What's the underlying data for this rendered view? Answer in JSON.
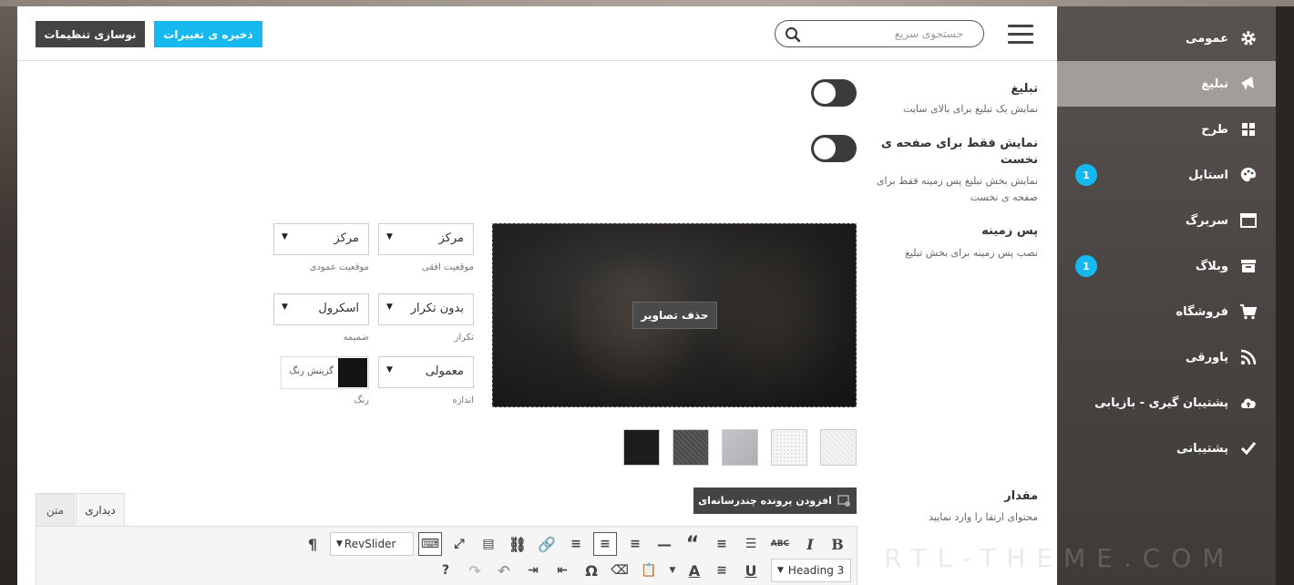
{
  "header": {
    "reset_label": "نوسازی تنظیمات",
    "save_label": "ذخیره ی تغییرات",
    "search_placeholder": "جستجوی سریع"
  },
  "sidebar": {
    "items": [
      {
        "label": "عمومی",
        "icon": "gear-icon"
      },
      {
        "label": "تبلیغ",
        "icon": "megaphone-icon",
        "active": true
      },
      {
        "label": "طرح",
        "icon": "grid-icon"
      },
      {
        "label": "استایل",
        "icon": "palette-icon",
        "badge": "1"
      },
      {
        "label": "سربرگ",
        "icon": "window-icon"
      },
      {
        "label": "وبلاگ",
        "icon": "archive-icon",
        "badge": "1"
      },
      {
        "label": "فروشگاه",
        "icon": "cart-icon"
      },
      {
        "label": "پاورقی",
        "icon": "rss-icon"
      },
      {
        "label": "پشتیبان گیری - بازیابی",
        "icon": "cloud-upload-icon"
      },
      {
        "label": "پشتیبانی",
        "icon": "check-icon"
      }
    ]
  },
  "settings": {
    "ad": {
      "label": "تبلیغ",
      "desc": "نمایش یک تبلیغ برای بالای سایت",
      "enabled": false
    },
    "homepage_only": {
      "label": "نمایش فقط برای صفحه ی نخست",
      "desc": "نمایش بخش تبلیغ پس زمینه فقط برای صفحه ی نخست",
      "enabled": false
    },
    "background": {
      "label": "پس زمینه",
      "desc": "نصب پس زمینه برای بخش تبلیغ",
      "remove_images_label": "حذف تصاویر",
      "h_position": {
        "value": "مرکز",
        "label": "موقعیت افقی"
      },
      "v_position": {
        "value": "مرکز",
        "label": "موقعیت عمودی"
      },
      "repeat": {
        "value": "بدون تکرار",
        "label": "تکرار"
      },
      "attachment": {
        "value": "اسکرول",
        "label": "ضمیمه"
      },
      "size": {
        "value": "معمولی",
        "label": "اندازه"
      },
      "color": {
        "button_label": "گزینش رنگ",
        "label": "رنگ",
        "value": "#141414"
      },
      "patterns": [
        "#f3f3f3",
        "#efefef",
        "#b9b9bd",
        "#555555",
        "#1c1c1c"
      ]
    },
    "content": {
      "label": "مقدار",
      "desc": "محتوای ارتقا را وارد نمایید",
      "add_media_label": "افزودن پرونده چندرسانه‌ای",
      "tabs": [
        "دیداری",
        "متن"
      ],
      "format_select": "Heading 3",
      "shortcode_select": "RevSlider"
    }
  },
  "watermark": "RTL-THEME.COM"
}
